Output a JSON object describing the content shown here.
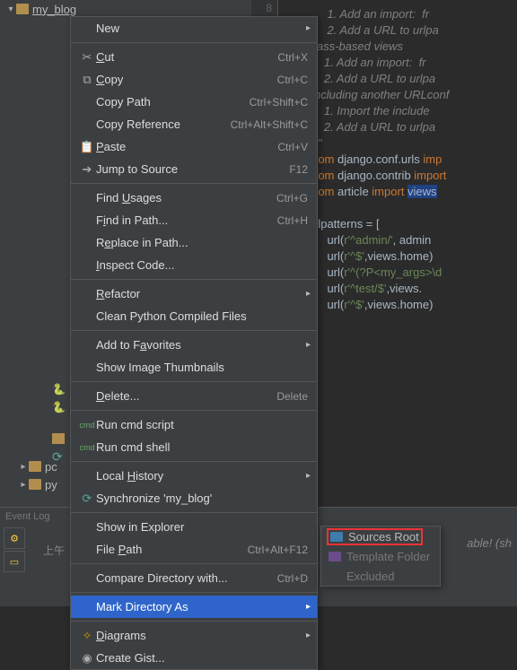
{
  "tree": {
    "root": "my_blog",
    "pc": "pc",
    "py": "py"
  },
  "gutter": {
    "start": 8
  },
  "editor": {
    "l1": "    1. Add an import:  fr",
    "l2": "    2. Add a URL to urlpa",
    "l3": "lass-based views",
    "l4": "   1. Add an import:  fr",
    "l5": "   2. Add a URL to urlpa",
    "l6": "ncluding another URLconf",
    "l7": "   1. Import the include",
    "l8": "   2. Add a URL to urlpa",
    "l9": "\"\"",
    "l10a": "rom ",
    "l10b": "django.conf.urls ",
    "l10c": "imp",
    "l11a": "rom ",
    "l11b": "django.contrib ",
    "l11c": "import",
    "l12a": "rom ",
    "l12b": "article ",
    "l12c": "import ",
    "l12d": "views",
    "l14": "rlpatterns = [",
    "l15a": "    url(",
    "l15b": "r'^admin/'",
    "l15c": ", admin",
    "l16a": "    url(",
    "l16b": "r'^$'",
    "l16c": ",views.home)",
    "l17a": "    url(",
    "l17b": "r'^(?P<my_args>\\d",
    "l18a": "    url(",
    "l18b": "r'^test/$'",
    "l18c": ",views.",
    "l19a": "    url(",
    "l19b": "r'^$'",
    "l19c": ",views.home)"
  },
  "menu": {
    "new": "New",
    "cut": "Cut",
    "cut_sc": "Ctrl+X",
    "copy": "Copy",
    "copy_sc": "Ctrl+C",
    "copy_path": "Copy Path",
    "copy_path_sc": "Ctrl+Shift+C",
    "copy_ref": "Copy Reference",
    "copy_ref_sc": "Ctrl+Alt+Shift+C",
    "paste": "Paste",
    "paste_sc": "Ctrl+V",
    "jump": "Jump to Source",
    "jump_sc": "F12",
    "find_usages": "Find Usages",
    "find_usages_sc": "Ctrl+G",
    "find_in_path": "Find in Path...",
    "find_in_path_sc": "Ctrl+H",
    "replace": "Replace in Path...",
    "inspect": "Inspect Code...",
    "refactor": "Refactor",
    "clean": "Clean Python Compiled Files",
    "fav": "Add to Favorites",
    "thumb": "Show Image Thumbnails",
    "delete": "Delete...",
    "delete_sc": "Delete",
    "run_script": "Run cmd script",
    "run_shell": "Run cmd shell",
    "history": "Local History",
    "sync": "Synchronize 'my_blog'",
    "explorer": "Show in Explorer",
    "file_path": "File Path",
    "file_path_sc": "Ctrl+Alt+F12",
    "compare": "Compare Directory with...",
    "compare_sc": "Ctrl+D",
    "mark": "Mark Directory As",
    "diagrams": "Diagrams",
    "gist": "Create Gist..."
  },
  "submenu": {
    "sources": "Sources Root",
    "template": "Template Folder",
    "excluded": "Excluded"
  },
  "eventlog": {
    "title": "Event Log",
    "time": "上午",
    "tail": "able! (sh"
  }
}
